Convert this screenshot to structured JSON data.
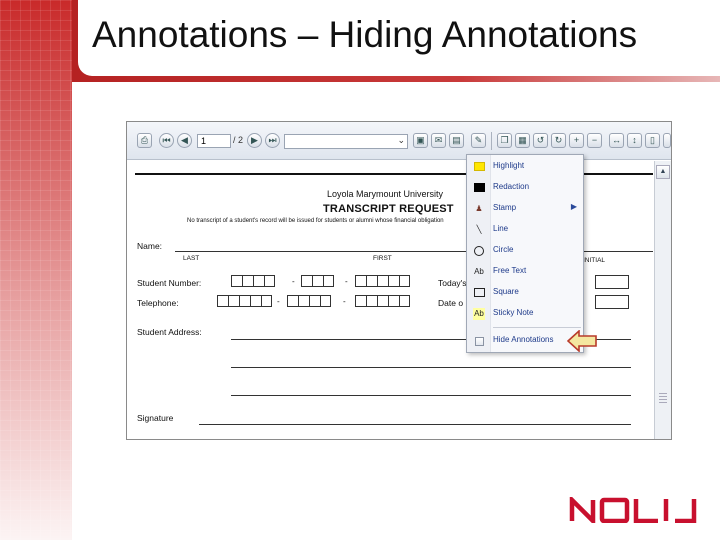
{
  "slide": {
    "title": "Annotations – Hiding Annotations",
    "accent_color": "#c92a2a"
  },
  "toolbar": {
    "page_number": "1",
    "page_of": "/ 2",
    "buttons": [
      "print-icon",
      "first-page-icon",
      "prev-page-icon",
      "next-page-icon",
      "last-page-icon",
      "save-icon",
      "email-icon",
      "scan-icon",
      "annotate-icon",
      "copy-icon",
      "paste-icon",
      "rotate-left-icon",
      "rotate-right-icon",
      "zoom-in-icon",
      "zoom-out-icon",
      "fit-width-icon",
      "fit-height-icon",
      "single-page-icon",
      "two-page-icon"
    ]
  },
  "document": {
    "university": "Loyola Marymount University",
    "form_title": "TRANSCRIPT REQUEST",
    "notice": "No transcript of a student's record will be issued for students or alumni whose financial obligation",
    "name_label": "Name:",
    "last_label": "LAST",
    "first_label": "FIRST",
    "initial_label": "INITIAL",
    "student_number_label": "Student Number:",
    "todays_label": "Today's",
    "telephone_label": "Telephone:",
    "date_label": "Date o",
    "student_address_label": "Student Address:",
    "signature_label": "Signature",
    "dash": "-"
  },
  "menu": {
    "items": [
      {
        "label": "Highlight",
        "icon": "highlight-icon",
        "color": "#ffe600"
      },
      {
        "label": "Redaction",
        "icon": "redaction-icon",
        "color": "#000000"
      },
      {
        "label": "Stamp",
        "icon": "stamp-icon",
        "has_submenu": true
      },
      {
        "label": "Line",
        "icon": "line-icon"
      },
      {
        "label": "Circle",
        "icon": "circle-icon"
      },
      {
        "label": "Free Text",
        "icon": "free-text-icon",
        "glyph": "Ab"
      },
      {
        "label": "Square",
        "icon": "square-icon"
      },
      {
        "label": "Sticky Note",
        "icon": "sticky-note-icon",
        "glyph": "Ab",
        "color": "#ffffa0"
      },
      {
        "label": "Hide Annotations",
        "icon": "checkbox-icon"
      }
    ]
  },
  "logo": {
    "text": "NOLIJ",
    "color": "#c8102e"
  }
}
